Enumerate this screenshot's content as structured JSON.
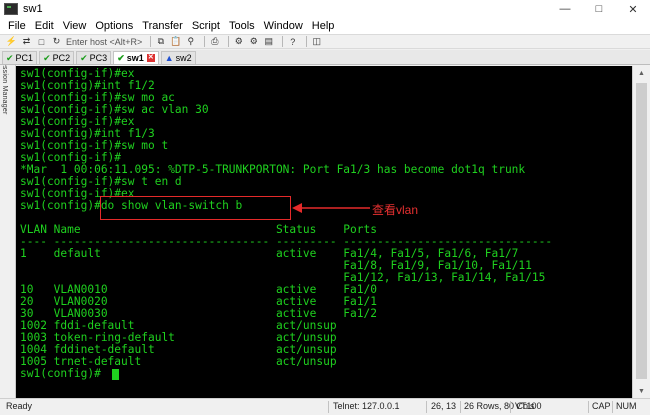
{
  "window": {
    "title": "sw1"
  },
  "menu": [
    "File",
    "Edit",
    "View",
    "Options",
    "Transfer",
    "Script",
    "Tools",
    "Window",
    "Help"
  ],
  "toolbar": {
    "host_placeholder": "Enter host <Alt+R>"
  },
  "tabs": [
    {
      "label": "PC1",
      "status": "ok"
    },
    {
      "label": "PC2",
      "status": "ok"
    },
    {
      "label": "PC3",
      "status": "ok"
    },
    {
      "label": "sw1",
      "status": "ok",
      "active": true
    },
    {
      "label": "sw2",
      "status": "warn"
    }
  ],
  "session_manager": {
    "label": "Session Manager"
  },
  "terminal": {
    "lines": [
      "sw1(config-if)#ex",
      "sw1(config)#int f1/2",
      "sw1(config-if)#sw mo ac",
      "sw1(config-if)#sw ac vlan 30",
      "sw1(config-if)#ex",
      "sw1(config)#int f1/3",
      "sw1(config-if)#sw mo t",
      "sw1(config-if)#",
      "*Mar  1 00:06:11.095: %DTP-5-TRUNKPORTON: Port Fa1/3 has become dot1q trunk",
      "sw1(config-if)#sw t en d",
      "sw1(config-if)#ex",
      "sw1(config)#do show vlan-switch b",
      "",
      "VLAN Name                             Status    Ports",
      "---- -------------------------------- --------- -------------------------------",
      "1    default                          active    Fa1/4, Fa1/5, Fa1/6, Fa1/7",
      "                                                Fa1/8, Fa1/9, Fa1/10, Fa1/11",
      "                                                Fa1/12, Fa1/13, Fa1/14, Fa1/15",
      "10   VLAN0010                         active    Fa1/0",
      "20   VLAN0020                         active    Fa1/1",
      "30   VLAN0030                         active    Fa1/2",
      "1002 fddi-default                     act/unsup",
      "1003 token-ring-default               act/unsup",
      "1004 fddinet-default                  act/unsup",
      "1005 trnet-default                    act/unsup",
      "sw1(config)#"
    ]
  },
  "annotation": {
    "label": "查看vlan",
    "color": "#e52a2a"
  },
  "status": {
    "ready": "Ready",
    "connection": "Telnet: 127.0.0.1",
    "position": "26, 13",
    "size": "26 Rows, 80 Cols",
    "terminal_type": "VT100",
    "caps": "CAP",
    "num": "NUM"
  },
  "colors": {
    "terminal_fg": "#1fd11f",
    "terminal_bg": "#000000"
  }
}
